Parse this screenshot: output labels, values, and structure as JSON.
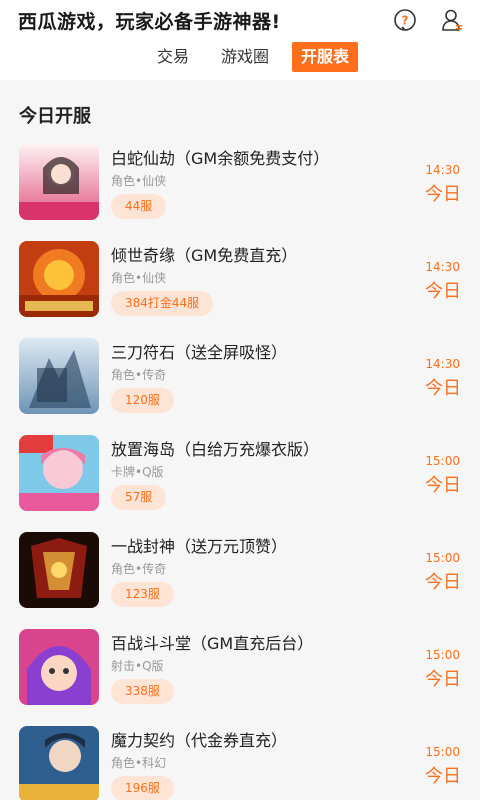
{
  "header": {
    "title": "西瓜游戏，玩家必备手游神器!",
    "tabs": [
      {
        "label": "交易"
      },
      {
        "label": "游戏圈"
      },
      {
        "label": "开服表"
      }
    ],
    "icons": [
      "help-icon",
      "user-icon"
    ],
    "accent_color": "#ff6f1b"
  },
  "section": {
    "title": "今日开服"
  },
  "games": [
    {
      "name": "白蛇仙劫（GM余额免费支付）",
      "category": "角色•仙侠",
      "badge": "44服",
      "time": "14:30",
      "day": "今日",
      "thumb_color": "#e25a83"
    },
    {
      "name": "倾世奇缘（GM免费直充）",
      "category": "角色•仙侠",
      "badge": "384打金44服",
      "time": "14:30",
      "day": "今日",
      "thumb_color": "#e5541e"
    },
    {
      "name": "三刀符石（送全屏吸怪）",
      "category": "角色•传奇",
      "badge": "120服",
      "time": "14:30",
      "day": "今日",
      "thumb_color": "#7fa9c9"
    },
    {
      "name": "放置海岛（白给万充爆衣版）",
      "category": "卡牌•Q版",
      "badge": "57服",
      "time": "15:00",
      "day": "今日",
      "thumb_color": "#f39ac0"
    },
    {
      "name": "一战封神（送万元顶赞）",
      "category": "角色•传奇",
      "badge": "123服",
      "time": "15:00",
      "day": "今日",
      "thumb_color": "#8c1c12"
    },
    {
      "name": "百战斗斗堂（GM直充后台）",
      "category": "射击•Q版",
      "badge": "338服",
      "time": "15:00",
      "day": "今日",
      "thumb_color": "#9b4fd6"
    },
    {
      "name": "魔力契约（代金券直充）",
      "category": "角色•科幻",
      "badge": "196服",
      "time": "15:00",
      "day": "今日",
      "thumb_color": "#3d7fb8"
    }
  ]
}
